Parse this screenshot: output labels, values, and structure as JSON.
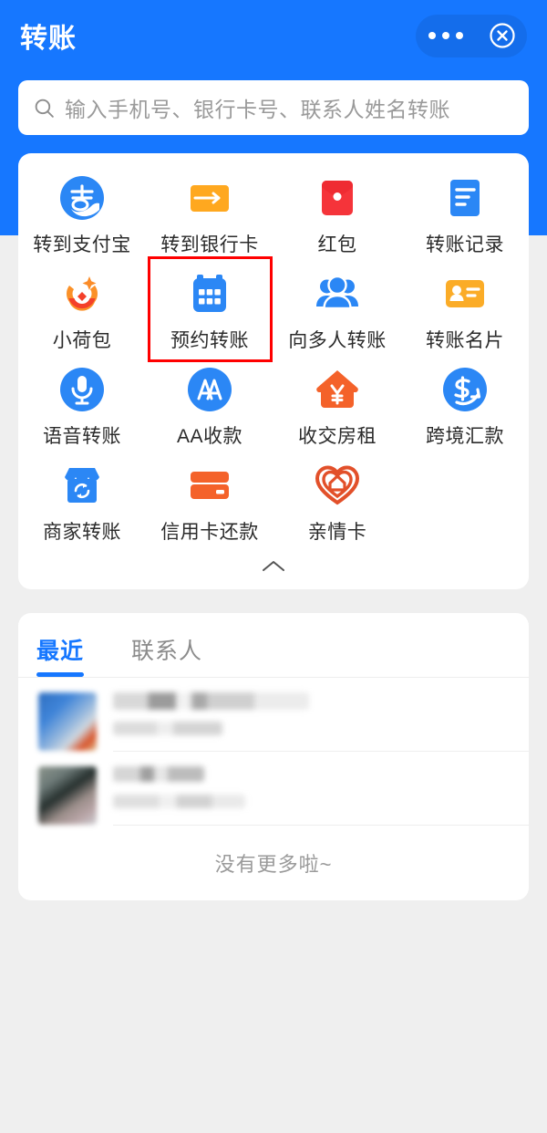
{
  "header": {
    "title": "转账",
    "more_icon": "more-dots-icon",
    "close_icon": "close-circle-icon",
    "accent_color": "#1677ff"
  },
  "search": {
    "icon": "search-icon",
    "placeholder": "输入手机号、银行卡号、联系人姓名转账",
    "value": ""
  },
  "grid": {
    "collapse_icon": "chevron-up-icon",
    "highlighted_index": 5,
    "highlight_color": "#ff0000",
    "items": [
      {
        "label": "转到支付宝",
        "icon": "alipay-logo-icon",
        "color": "#1677ff"
      },
      {
        "label": "转到银行卡",
        "icon": "bank-card-arrow-icon",
        "color": "#ffa81f"
      },
      {
        "label": "红包",
        "icon": "red-packet-icon",
        "color": "#f5343a"
      },
      {
        "label": "转账记录",
        "icon": "transfer-record-icon",
        "color": "#2b87f5"
      },
      {
        "label": "小荷包",
        "icon": "pouch-sparkle-icon",
        "color": "#f97c2a"
      },
      {
        "label": "预约转账",
        "icon": "calendar-icon",
        "color": "#2b87f5"
      },
      {
        "label": "向多人转账",
        "icon": "multiple-people-icon",
        "color": "#2b87f5"
      },
      {
        "label": "转账名片",
        "icon": "contact-card-icon",
        "color": "#fbac27"
      },
      {
        "label": "语音转账",
        "icon": "microphone-icon",
        "color": "#2b87f5"
      },
      {
        "label": "AA收款",
        "icon": "aa-split-icon",
        "color": "#2b87f5"
      },
      {
        "label": "收交房租",
        "icon": "house-yuan-icon",
        "color": "#f4622a"
      },
      {
        "label": "跨境汇款",
        "icon": "dollar-arrow-icon",
        "color": "#2b87f5"
      },
      {
        "label": "商家转账",
        "icon": "merchant-shop-icon",
        "color": "#2b87f5"
      },
      {
        "label": "信用卡还款",
        "icon": "credit-card-icon",
        "color": "#f4622a"
      },
      {
        "label": "亲情卡",
        "icon": "heart-house-icon",
        "color": "#e2502a"
      }
    ]
  },
  "list": {
    "tabs": [
      {
        "label": "最近",
        "active": true
      },
      {
        "label": "联系人",
        "active": false
      }
    ],
    "rows": [
      {
        "avatar": "contact-avatar",
        "name": "",
        "subtitle": ""
      },
      {
        "avatar": "contact-avatar",
        "name": "",
        "subtitle": ""
      }
    ],
    "footer_text": "没有更多啦~"
  }
}
